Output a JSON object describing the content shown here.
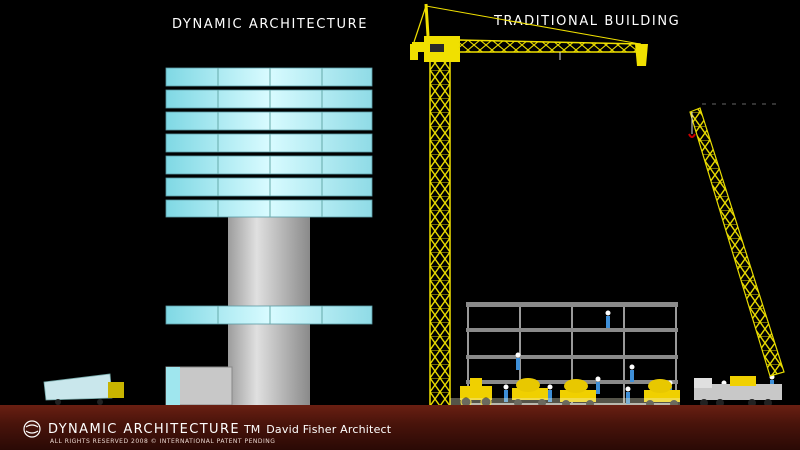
{
  "labels": {
    "dynamic": "DYNAMIC ARCHITECTURE",
    "traditional": "TRADITIONAL BUILDING"
  },
  "footer": {
    "brand": "DYNAMIC ARCHITECTURE",
    "tm": "TM",
    "architect": "David Fisher Architect",
    "rights": "ALL RIGHTS RESERVED 2008 © INTERNATIONAL PATENT PENDING"
  },
  "colors": {
    "background": "#000000",
    "glass": "#9fe6ee",
    "crane": "#f0e000",
    "ground": "#5a1a10",
    "concrete": "#b8b8b8"
  }
}
